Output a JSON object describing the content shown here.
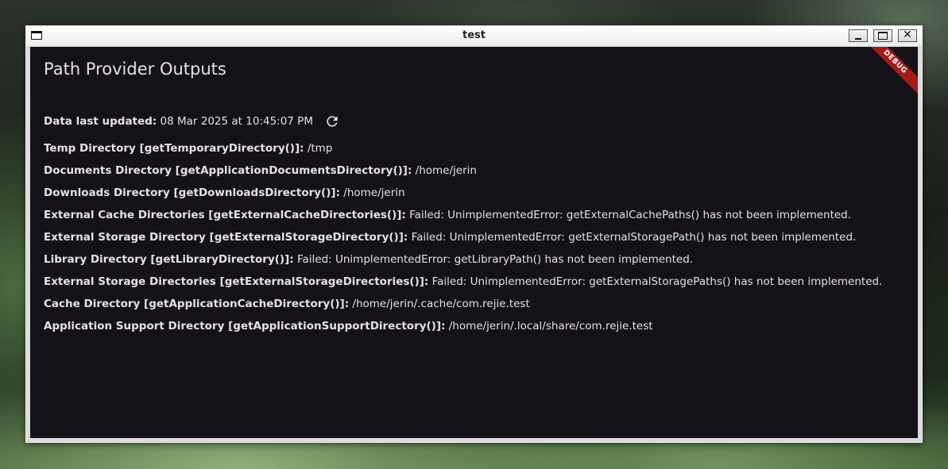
{
  "window": {
    "title": "test"
  },
  "app": {
    "title": "Path Provider Outputs",
    "debug_banner": "DEBUG",
    "last_updated_label": "Data last updated:",
    "last_updated_value": " 08 Mar 2025 at 10:45:07 PM",
    "refresh_icon": "refresh-icon"
  },
  "rows": [
    {
      "key": "Temp Directory [getTemporaryDirectory()]:",
      "value": " /tmp"
    },
    {
      "key": "Documents Directory [getApplicationDocumentsDirectory()]:",
      "value": " /home/jerin"
    },
    {
      "key": "Downloads Directory [getDownloadsDirectory()]:",
      "value": " /home/jerin"
    },
    {
      "key": "External Cache Directories [getExternalCacheDirectories()]:",
      "value": " Failed: UnimplementedError: getExternalCachePaths() has not been implemented."
    },
    {
      "key": "External Storage Directory [getExternalStorageDirectory()]:",
      "value": " Failed: UnimplementedError: getExternalStoragePath() has not been implemented."
    },
    {
      "key": "Library Directory [getLibraryDirectory()]:",
      "value": " Failed: UnimplementedError: getLibraryPath() has not been implemented."
    },
    {
      "key": "External Storage Directories [getExternalStorageDirectories()]:",
      "value": " Failed: UnimplementedError: getExternalStoragePaths() has not been implemented."
    },
    {
      "key": "Cache Directory [getApplicationCacheDirectory()]:",
      "value": " /home/jerin/.cache/com.rejie.test"
    },
    {
      "key": "Application Support Directory [getApplicationSupportDirectory()]:",
      "value": " /home/jerin/.local/share/com.rejie.test"
    }
  ],
  "colors": {
    "surface": "#141218",
    "on_surface": "#e6e0e9",
    "debug_banner": "#a11b1b"
  }
}
